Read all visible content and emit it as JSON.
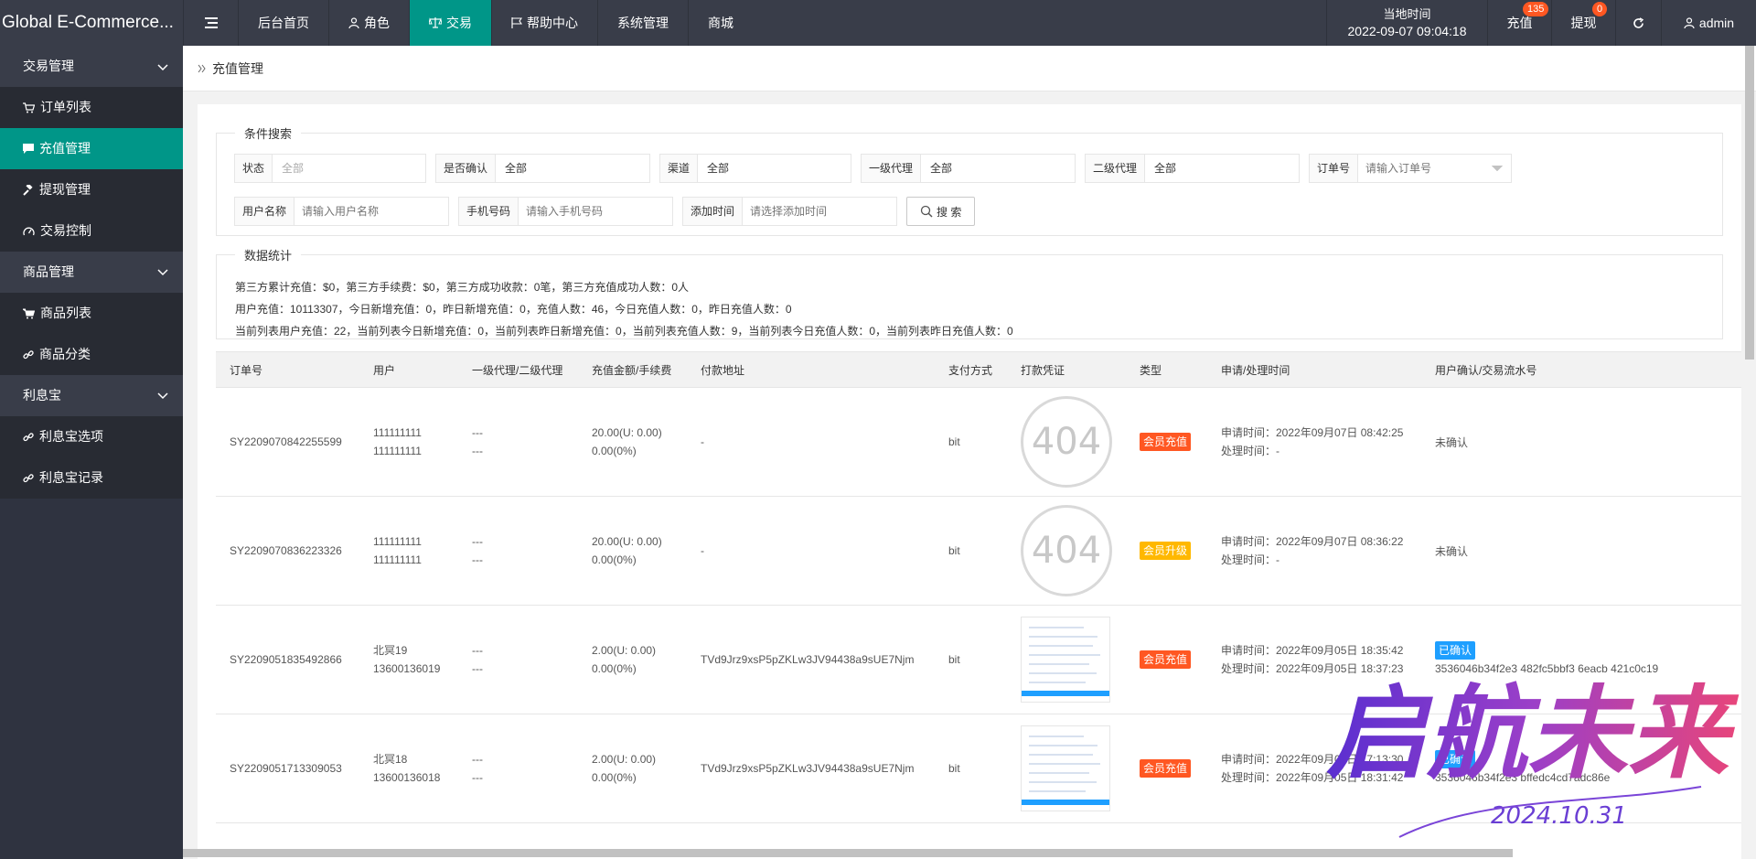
{
  "app": {
    "title": "Global E-Commerce..."
  },
  "nav": {
    "items": [
      {
        "label": "后台首页"
      },
      {
        "label": "角色"
      },
      {
        "label": "交易"
      },
      {
        "label": "帮助中心"
      },
      {
        "label": "系统管理"
      },
      {
        "label": "商城"
      }
    ]
  },
  "header": {
    "time_label": "当地时间",
    "time_value": "2022-09-07 09:04:18",
    "recharge_label": "充值",
    "recharge_badge": "135",
    "withdraw_label": "提现",
    "withdraw_badge": "0",
    "user": "admin"
  },
  "sidebar": {
    "groups": [
      {
        "label": "交易管理",
        "items": [
          "订单列表",
          "充值管理",
          "提现管理",
          "交易控制"
        ]
      },
      {
        "label": "商品管理",
        "items": [
          "商品列表",
          "商品分类"
        ]
      },
      {
        "label": "利息宝",
        "items": [
          "利息宝选项",
          "利息宝记录"
        ]
      }
    ]
  },
  "breadcrumb": {
    "current": "充值管理"
  },
  "search": {
    "legend": "条件搜索",
    "fields": {
      "status": {
        "label": "状态",
        "value": "全部"
      },
      "confirmed": {
        "label": "是否确认",
        "value": "全部"
      },
      "channel": {
        "label": "渠道",
        "value": "全部"
      },
      "agent1": {
        "label": "一级代理",
        "value": "全部"
      },
      "agent2": {
        "label": "二级代理",
        "value": "全部"
      },
      "order_no": {
        "label": "订单号",
        "placeholder": "请输入订单号"
      },
      "username": {
        "label": "用户名称",
        "placeholder": "请输入用户名称"
      },
      "phone": {
        "label": "手机号码",
        "placeholder": "请输入手机号码"
      },
      "added_time": {
        "label": "添加时间",
        "placeholder": "请选择添加时间"
      }
    },
    "button": "搜 索"
  },
  "stats": {
    "legend": "数据统计",
    "lines": [
      "第三方累计充值：$0，第三方手续费：$0，第三方成功收款：0笔，第三方充值成功人数：0人",
      "用户充值：10113307，今日新增充值：0，昨日新增充值：0，充值人数：46，今日充值人数：0，昨日充值人数：0",
      "当前列表用户充值：22，当前列表今日新增充值：0，当前列表昨日新增充值：0，当前列表充值人数：9，当前列表今日充值人数：0，当前列表昨日充值人数：0"
    ]
  },
  "table": {
    "headers": [
      "订单号",
      "用户",
      "一级代理/二级代理",
      "充值金额/手续费",
      "付款地址",
      "支付方式",
      "打款凭证",
      "类型",
      "申请/处理时间",
      "用户确认/交易流水号"
    ],
    "rows": [
      {
        "order": "SY2209070842255599",
        "user1": "111111111",
        "user2": "111111111",
        "agent1": "---",
        "agent2": "---",
        "amount": "20.00(U: 0.00)",
        "fee": "0.00(0%)",
        "address": "-",
        "pay": "bit",
        "proof": "404",
        "type": "会员充值",
        "apply": "申请时间：2022年09月07日 08:42:25",
        "process": "处理时间：-",
        "confirm": "未确认",
        "txid": ""
      },
      {
        "order": "SY2209070836223326",
        "user1": "111111111",
        "user2": "111111111",
        "agent1": "---",
        "agent2": "---",
        "amount": "20.00(U: 0.00)",
        "fee": "0.00(0%)",
        "address": "-",
        "pay": "bit",
        "proof": "404",
        "type": "会员升级",
        "apply": "申请时间：2022年09月07日 08:36:22",
        "process": "处理时间：-",
        "confirm": "未确认",
        "txid": ""
      },
      {
        "order": "SY2209051835492866",
        "user1": "北冥19",
        "user2": "13600136019",
        "agent1": "---",
        "agent2": "---",
        "amount": "2.00(U: 0.00)",
        "fee": "0.00(0%)",
        "address": "TVd9Jrz9xsP5pZKLw3JV94438a9sUE7Njm",
        "pay": "bit",
        "proof": "",
        "type": "会员充值",
        "apply": "申请时间：2022年09月05日 18:35:42",
        "process": "处理时间：2022年09月05日 18:37:23",
        "confirm": "已确认",
        "txid": "3536046b34f2e3 482fc5bbf3 6eacb 421c0c19"
      },
      {
        "order": "SY2209051713309053",
        "user1": "北冥18",
        "user2": "13600136018",
        "agent1": "---",
        "agent2": "---",
        "amount": "2.00(U: 0.00)",
        "fee": "0.00(0%)",
        "address": "TVd9Jrz9xsP5pZKLw3JV94438a9sUE7Njm",
        "pay": "bit",
        "proof": "",
        "type": "会员充值",
        "apply": "申请时间：2022年09月05日 17:13:30",
        "process": "处理时间：2022年09月05日 18:31:42",
        "confirm": "已确认",
        "txid": "3536046b34f2e3 bffedc4cd7adc86e"
      }
    ]
  },
  "watermark": {
    "text": "启航未来",
    "sub": "2024.10.31"
  },
  "colors": {
    "topbar": "#393d49",
    "sidebar": "#2f3340",
    "active": "#009688",
    "red_tag": "#ff5722",
    "yellow_tag": "#ffb800",
    "blue_tag": "#1e9fff"
  }
}
